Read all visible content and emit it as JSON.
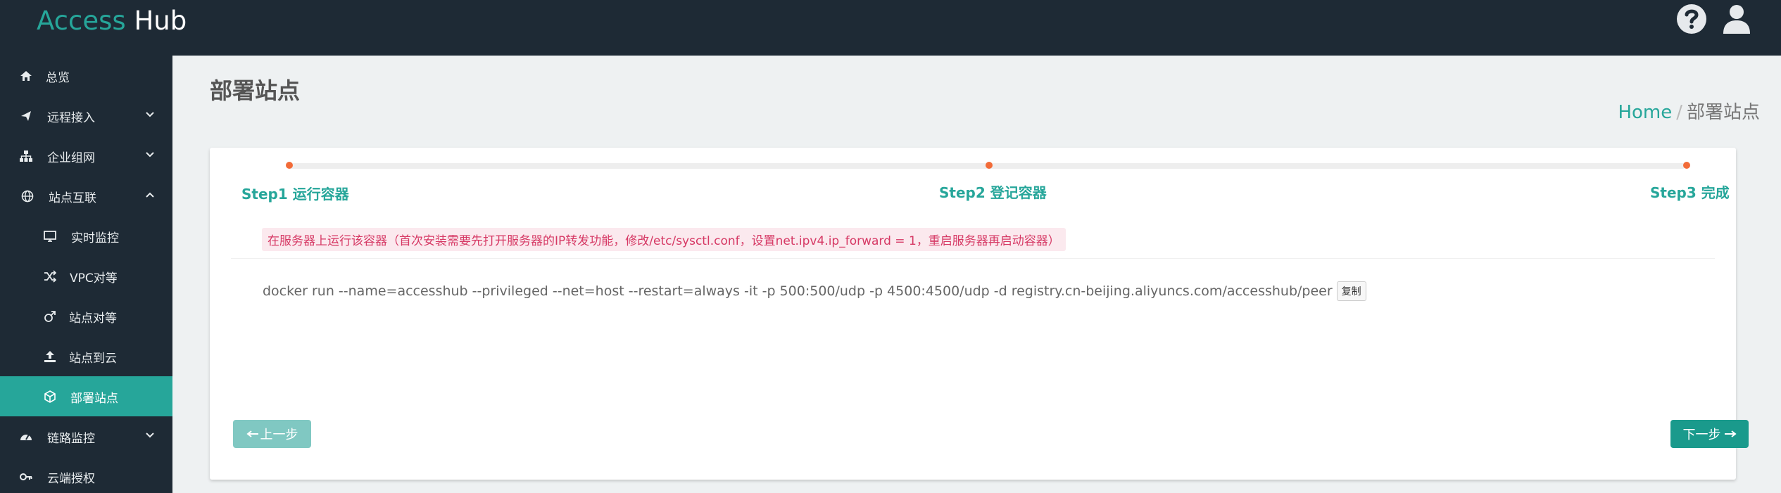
{
  "header": {
    "brand_part1": "Access",
    "brand_part2": "Hub",
    "icons": [
      "question-circle-icon",
      "user-icon"
    ]
  },
  "sidebar": {
    "items": [
      {
        "label": "总览",
        "icon": "home-icon"
      },
      {
        "label": "远程接入",
        "icon": "plane-icon",
        "chevron": "down"
      },
      {
        "label": "企业组网",
        "icon": "sitemap-icon",
        "chevron": "down"
      },
      {
        "label": "站点互联",
        "icon": "globe-icon",
        "chevron": "up"
      },
      {
        "label": "实时监控",
        "icon": "desktop-icon",
        "sub": true
      },
      {
        "label": "VPC对等",
        "icon": "random-icon",
        "sub": true
      },
      {
        "label": "站点对等",
        "icon": "mars-icon",
        "sub": true
      },
      {
        "label": "站点到云",
        "icon": "upload-icon",
        "sub": true
      },
      {
        "label": "部署站点",
        "icon": "cube-icon",
        "sub": true,
        "active": true
      },
      {
        "label": "链路监控",
        "icon": "dashboard-icon",
        "chevron": "down"
      },
      {
        "label": "云端授权",
        "icon": "key-icon"
      }
    ]
  },
  "page": {
    "title": "部署站点",
    "breadcrumb_home": "Home",
    "breadcrumb_sep": "/",
    "breadcrumb_current": "部署站点"
  },
  "wizard": {
    "steps": [
      "Step1 运行容器",
      "Step2 登记容器",
      "Step3 完成"
    ],
    "current_step": 1,
    "warning": "在服务器上运行该容器（首次安装需要先打开服务器的IP转发功能，修改/etc/sysctl.conf，设置net.ipv4.ip_forward = 1，重启服务器再启动容器）",
    "command": "docker run --name=accesshub --privileged --net=host --restart=always -it -p 500:500/udp -p 4500:4500/udp -d registry.cn-beijing.aliyuncs.com/accesshub/peer",
    "copy_label": "复制",
    "prev_label": "上一步",
    "next_label": "下一步"
  },
  "colors": {
    "topbar": "#1e2a35",
    "accent": "#26a69a",
    "step_dot": "#f26b38",
    "warning_text": "#d63864",
    "warning_bg": "#fbe9ee"
  }
}
